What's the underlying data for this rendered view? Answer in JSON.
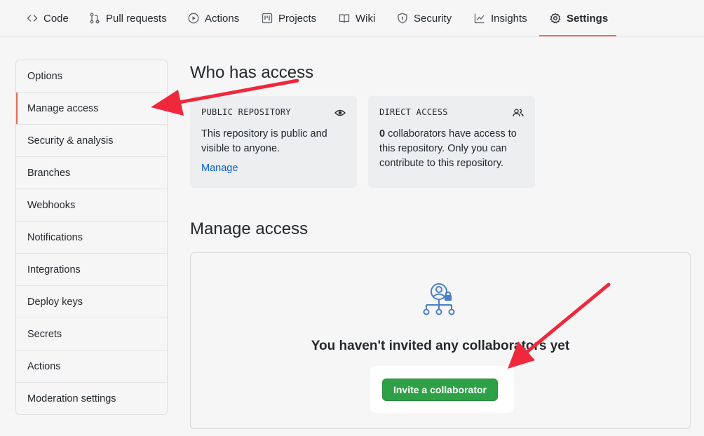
{
  "topnav": {
    "tabs": [
      {
        "label": "Code",
        "icon": "code-icon"
      },
      {
        "label": "Pull requests",
        "icon": "pull-request-icon"
      },
      {
        "label": "Actions",
        "icon": "play-icon"
      },
      {
        "label": "Projects",
        "icon": "project-icon"
      },
      {
        "label": "Wiki",
        "icon": "book-icon"
      },
      {
        "label": "Security",
        "icon": "shield-icon"
      },
      {
        "label": "Insights",
        "icon": "graph-icon"
      },
      {
        "label": "Settings",
        "icon": "gear-icon",
        "active": true
      }
    ]
  },
  "sidebar": {
    "items": [
      {
        "label": "Options"
      },
      {
        "label": "Manage access",
        "active": true
      },
      {
        "label": "Security & analysis"
      },
      {
        "label": "Branches"
      },
      {
        "label": "Webhooks"
      },
      {
        "label": "Notifications"
      },
      {
        "label": "Integrations"
      },
      {
        "label": "Deploy keys"
      },
      {
        "label": "Secrets"
      },
      {
        "label": "Actions"
      },
      {
        "label": "Moderation settings"
      }
    ]
  },
  "who_has_access": {
    "title": "Who has access",
    "public_card": {
      "label": "PUBLIC REPOSITORY",
      "icon": "eye-icon",
      "text": "This repository is public and visible to anyone.",
      "link": "Manage"
    },
    "direct_card": {
      "label": "DIRECT ACCESS",
      "icon": "people-icon",
      "count": "0",
      "text": " collaborators have access to this repository. Only you can contribute to this repository."
    }
  },
  "manage_access": {
    "title": "Manage access",
    "empty_icon": "person-lock-icon",
    "empty_title": "You haven't invited any collaborators yet",
    "invite_button": "Invite a collaborator"
  },
  "colors": {
    "accent": "#e36d56",
    "link": "#0b5cd5",
    "primary_button": "#2ea146",
    "annotation_arrow": "#f0283c"
  }
}
